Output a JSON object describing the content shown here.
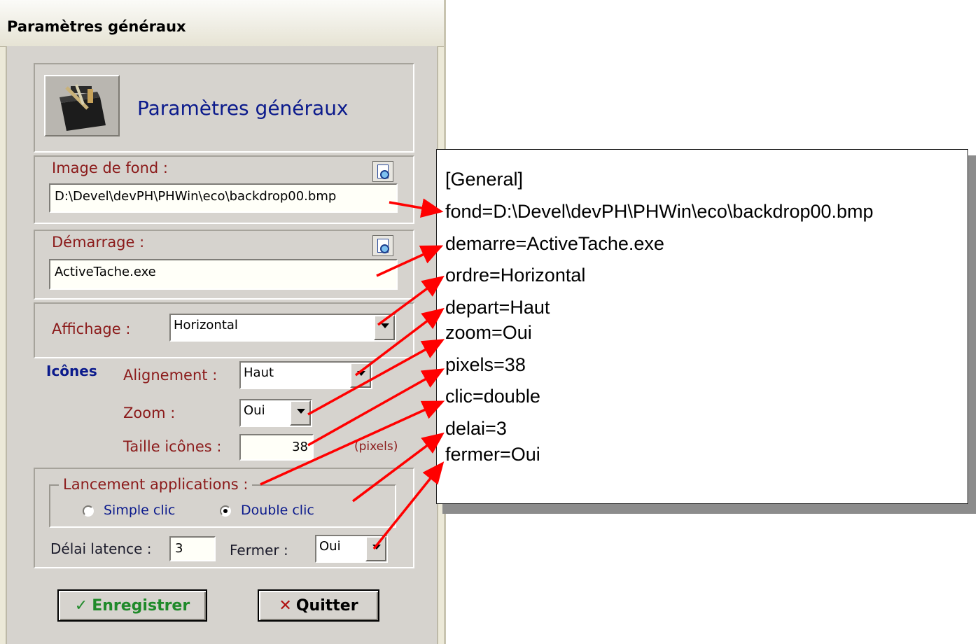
{
  "window": {
    "title": "Paramètres généraux"
  },
  "header": {
    "title": "Paramètres généraux",
    "icon": "toolbox-icon"
  },
  "background_image": {
    "label": "Image de fond :",
    "value": "D:\\Devel\\devPH\\PHWin\\eco\\backdrop00.bmp"
  },
  "startup": {
    "label": "Démarrage :",
    "value": "ActiveTache.exe"
  },
  "display": {
    "label": "Affichage :",
    "value": "Horizontal"
  },
  "icons": {
    "section_label": "Icônes",
    "alignment_label": "Alignement :",
    "alignment_value": "Haut",
    "zoom_label": "Zoom :",
    "zoom_value": "Oui",
    "size_label": "Taille icônes :",
    "size_value": "38",
    "size_unit": "(pixels)"
  },
  "launch": {
    "group_label": "Lancement applications :",
    "single_click_label": "Simple clic",
    "double_click_label": "Double clic",
    "selected": "double"
  },
  "latency": {
    "label": "Délai latence :",
    "value": "3"
  },
  "close": {
    "label": "Fermer :",
    "value": "Oui"
  },
  "buttons": {
    "save_label": "Enregistrer",
    "save_icon": "✓",
    "quit_label": "Quitter",
    "quit_icon": "✕"
  },
  "ini_file": {
    "lines": [
      "[General]",
      "fond=D:\\Devel\\devPH\\PHWin\\eco\\backdrop00.bmp",
      "demarre=ActiveTache.exe",
      "ordre=Horizontal",
      "depart=Haut",
      "zoom=Oui",
      "pixels=38",
      "clic=double",
      "delai=3",
      "fermer=Oui"
    ]
  },
  "colors": {
    "arrow": "#ff0000",
    "label_red": "#8b1a1a",
    "title_blue": "#0b1a8c",
    "save_green": "#1f8a2a",
    "quit_red": "#b01010"
  }
}
